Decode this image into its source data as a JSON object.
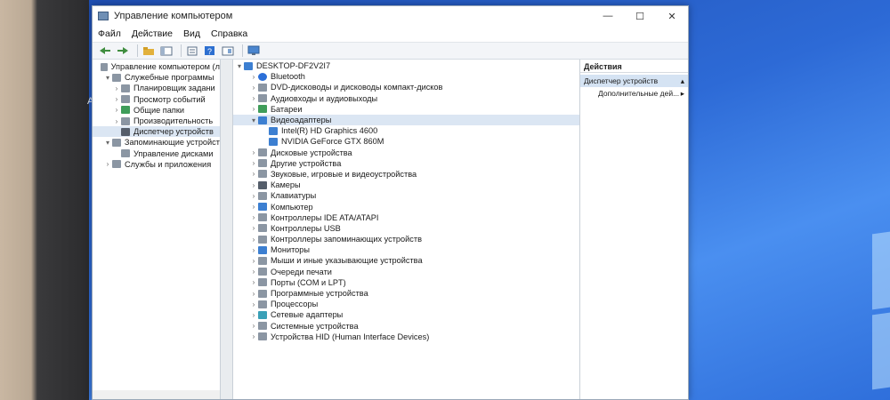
{
  "desktop": {
    "label_partial": "AC",
    "colors": {
      "background": "#2d6ad6",
      "window_bg": "#ffffff",
      "selection": "#dbe6f3"
    }
  },
  "window": {
    "title": "Управление компьютером",
    "controls": {
      "minimize": "—",
      "maximize": "☐",
      "close": "✕"
    }
  },
  "menu": [
    "Файл",
    "Действие",
    "Вид",
    "Справка"
  ],
  "toolbar": {
    "icons": [
      "back-arrow-icon",
      "forward-arrow-icon",
      "folder-up-icon",
      "console-tree-icon",
      "properties-icon",
      "help-icon",
      "view-icon",
      "monitor-icon"
    ]
  },
  "left_tree": [
    {
      "label": "Управление компьютером (л",
      "level": 0,
      "chevron": "",
      "icon": "gray"
    },
    {
      "label": "Служебные программы",
      "level": 1,
      "chevron": "▾",
      "icon": "gray"
    },
    {
      "label": "Планировщик задани",
      "level": 2,
      "chevron": "›",
      "icon": "gray"
    },
    {
      "label": "Просмотр событий",
      "level": 2,
      "chevron": "›",
      "icon": "gray"
    },
    {
      "label": "Общие папки",
      "level": 2,
      "chevron": "›",
      "icon": "green"
    },
    {
      "label": "Производительность",
      "level": 2,
      "chevron": "›",
      "icon": "gray"
    },
    {
      "label": "Диспетчер устройств",
      "level": 2,
      "chevron": "",
      "icon": "dark",
      "selected": true
    },
    {
      "label": "Запоминающие устройст",
      "level": 1,
      "chevron": "▾",
      "icon": "gray"
    },
    {
      "label": "Управление дисками",
      "level": 2,
      "chevron": "",
      "icon": "gray"
    },
    {
      "label": "Службы и приложения",
      "level": 1,
      "chevron": "›",
      "icon": "gray"
    }
  ],
  "device_tree": {
    "root": "DESKTOP-DF2V2I7",
    "items": [
      {
        "label": "Bluetooth",
        "level": 1,
        "chevron": "›",
        "icon": "bt"
      },
      {
        "label": "DVD-дисководы и дисководы компакт-дисков",
        "level": 1,
        "chevron": "›",
        "icon": "gray"
      },
      {
        "label": "Аудиовходы и аудиовыходы",
        "level": 1,
        "chevron": "›",
        "icon": "gray"
      },
      {
        "label": "Батареи",
        "level": 1,
        "chevron": "›",
        "icon": "green"
      },
      {
        "label": "Видеоадаптеры",
        "level": 1,
        "chevron": "▾",
        "icon": "blue",
        "selected": true
      },
      {
        "label": "Intel(R) HD Graphics 4600",
        "level": 2,
        "chevron": "",
        "icon": "blue"
      },
      {
        "label": "NVIDIA GeForce GTX 860M",
        "level": 2,
        "chevron": "",
        "icon": "blue"
      },
      {
        "label": "Дисковые устройства",
        "level": 1,
        "chevron": "›",
        "icon": "gray"
      },
      {
        "label": "Другие устройства",
        "level": 1,
        "chevron": "›",
        "icon": "gray"
      },
      {
        "label": "Звуковые, игровые и видеоустройства",
        "level": 1,
        "chevron": "›",
        "icon": "gray"
      },
      {
        "label": "Камеры",
        "level": 1,
        "chevron": "›",
        "icon": "dark"
      },
      {
        "label": "Клавиатуры",
        "level": 1,
        "chevron": "›",
        "icon": "gray"
      },
      {
        "label": "Компьютер",
        "level": 1,
        "chevron": "›",
        "icon": "blue"
      },
      {
        "label": "Контроллеры IDE ATA/ATAPI",
        "level": 1,
        "chevron": "›",
        "icon": "gray"
      },
      {
        "label": "Контроллеры USB",
        "level": 1,
        "chevron": "›",
        "icon": "gray"
      },
      {
        "label": "Контроллеры запоминающих устройств",
        "level": 1,
        "chevron": "›",
        "icon": "gray"
      },
      {
        "label": "Мониторы",
        "level": 1,
        "chevron": "›",
        "icon": "blue"
      },
      {
        "label": "Мыши и иные указывающие устройства",
        "level": 1,
        "chevron": "›",
        "icon": "gray"
      },
      {
        "label": "Очереди печати",
        "level": 1,
        "chevron": "›",
        "icon": "gray"
      },
      {
        "label": "Порты (COM и LPT)",
        "level": 1,
        "chevron": "›",
        "icon": "gray"
      },
      {
        "label": "Программные устройства",
        "level": 1,
        "chevron": "›",
        "icon": "gray"
      },
      {
        "label": "Процессоры",
        "level": 1,
        "chevron": "›",
        "icon": "gray"
      },
      {
        "label": "Сетевые адаптеры",
        "level": 1,
        "chevron": "›",
        "icon": "teal"
      },
      {
        "label": "Системные устройства",
        "level": 1,
        "chevron": "›",
        "icon": "gray"
      },
      {
        "label": "Устройства HID (Human Interface Devices)",
        "level": 1,
        "chevron": "›",
        "icon": "gray"
      }
    ]
  },
  "actions": {
    "header": "Действия",
    "selected": "Диспетчер устройств",
    "more": "Дополнительные дей...",
    "selected_arrow": "▴",
    "more_arrow": "▸"
  }
}
